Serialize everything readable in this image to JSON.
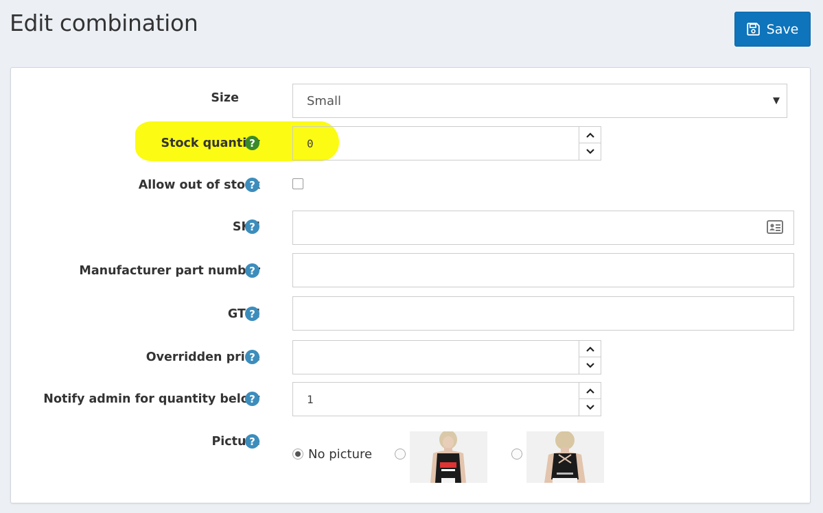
{
  "page": {
    "title": "Edit combination",
    "save_label": "Save"
  },
  "colors": {
    "accent": "#0e74bb",
    "help_icon": "#3c8dbc",
    "help_icon_highlighted": "#3a8a2a",
    "highlight": "#fbfb14",
    "background": "#ecf0f5"
  },
  "form": {
    "size": {
      "label": "Size",
      "value": "Small"
    },
    "stock_quantity": {
      "label": "Stock quantity",
      "value": "0"
    },
    "allow_out_of_stock": {
      "label": "Allow out of stock",
      "checked": false
    },
    "sku": {
      "label": "SKU",
      "value": "",
      "icon": "id-card-icon"
    },
    "manufacturer_part_number": {
      "label": "Manufacturer part number",
      "value": ""
    },
    "gtin": {
      "label": "GTIN",
      "value": ""
    },
    "overridden_price": {
      "label": "Overridden price",
      "value": ""
    },
    "notify_admin": {
      "label": "Notify admin for quantity below",
      "value": "1"
    },
    "picture": {
      "label": "Picture",
      "no_picture_label": "No picture",
      "selected": "No picture",
      "options": [
        "No picture",
        "tank-top-front-photo",
        "tank-top-back-photo"
      ]
    }
  },
  "help_icon_glyph": "?"
}
